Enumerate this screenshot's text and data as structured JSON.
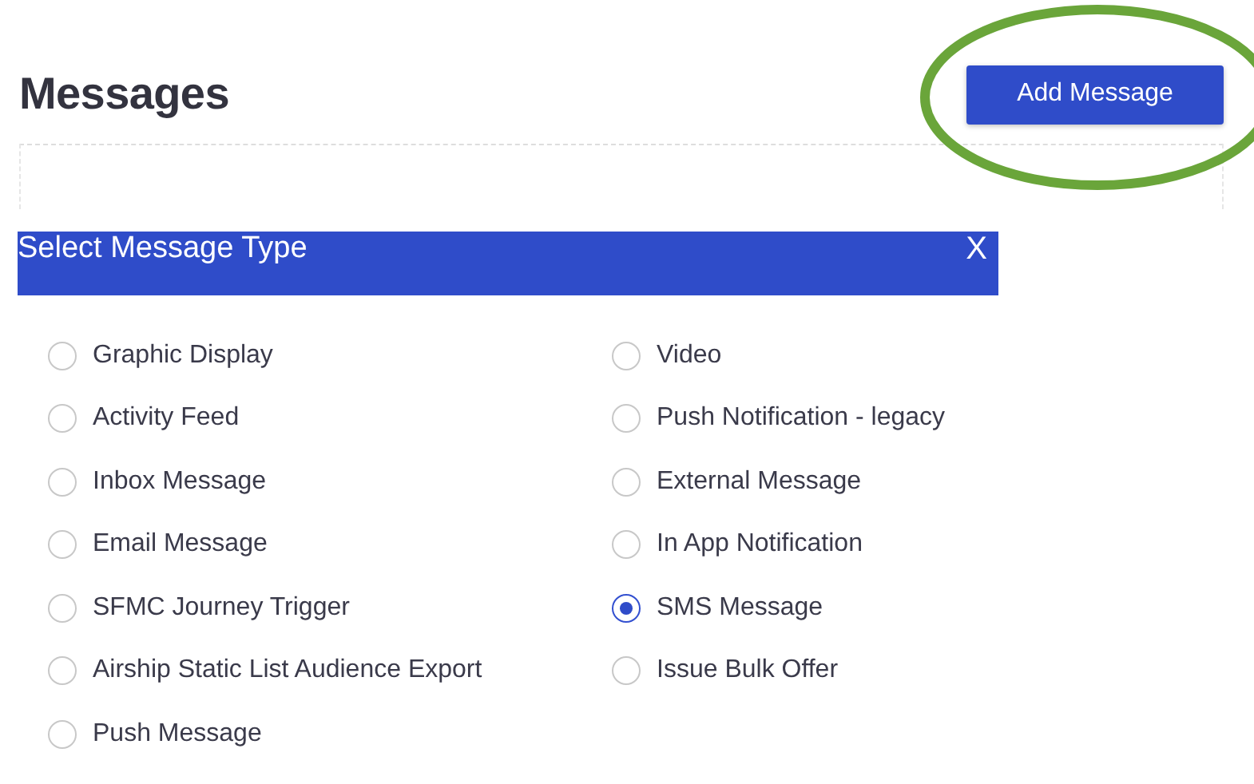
{
  "page": {
    "title": "Messages",
    "primary_button": "Add Message"
  },
  "dialog": {
    "title": "Select Message Type",
    "close": "X",
    "options": [
      {
        "label": "Graphic Display",
        "selected": false
      },
      {
        "label": "Activity Feed",
        "selected": false
      },
      {
        "label": "Inbox Message",
        "selected": false
      },
      {
        "label": "Email Message",
        "selected": false
      },
      {
        "label": "SFMC Journey Trigger",
        "selected": false
      },
      {
        "label": "Airship Static List Audience Export",
        "selected": false
      },
      {
        "label": "Push Message",
        "selected": false
      },
      {
        "label": "Video",
        "selected": false
      },
      {
        "label": "Push Notification - legacy",
        "selected": false
      },
      {
        "label": "External Message",
        "selected": false
      },
      {
        "label": "In App Notification",
        "selected": false
      },
      {
        "label": "SMS Message",
        "selected": true
      },
      {
        "label": "Issue Bulk Offer",
        "selected": false
      }
    ]
  }
}
